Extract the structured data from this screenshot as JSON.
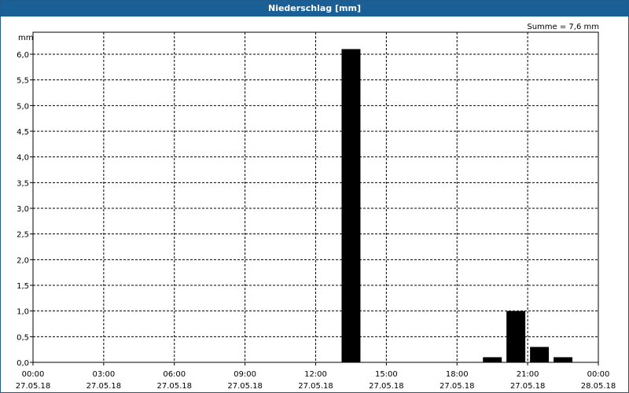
{
  "window": {
    "title": "Niederschlag [mm]"
  },
  "chart_data": {
    "type": "bar",
    "title": "Niederschlag [mm]",
    "annotation": "Summe = 7,6 mm",
    "ylabel": "mm",
    "ylim": [
      0,
      6.0
    ],
    "yticks": [
      "0,0",
      "0,5",
      "1,0",
      "1,5",
      "2,0",
      "2,5",
      "3,0",
      "3,5",
      "4,0",
      "4,5",
      "5,0",
      "5,5",
      "6,0"
    ],
    "xlim_hours": [
      0,
      24
    ],
    "xticks": [
      {
        "time": "00:00",
        "date": "27.05.18"
      },
      {
        "time": "03:00",
        "date": "27.05.18"
      },
      {
        "time": "06:00",
        "date": "27.05.18"
      },
      {
        "time": "09:00",
        "date": "27.05.18"
      },
      {
        "time": "12:00",
        "date": "27.05.18"
      },
      {
        "time": "15:00",
        "date": "27.05.18"
      },
      {
        "time": "18:00",
        "date": "27.05.18"
      },
      {
        "time": "21:00",
        "date": "27.05.18"
      },
      {
        "time": "00:00",
        "date": "28.05.18"
      }
    ],
    "bars": [
      {
        "start": "13:00",
        "end": "14:00",
        "value": 6.1
      },
      {
        "start": "19:00",
        "end": "20:00",
        "value": 0.1
      },
      {
        "start": "20:00",
        "end": "21:00",
        "value": 1.0
      },
      {
        "start": "21:00",
        "end": "22:00",
        "value": 0.3
      },
      {
        "start": "22:00",
        "end": "23:00",
        "value": 0.1
      }
    ],
    "grid": true,
    "bar_color": "#000000"
  }
}
